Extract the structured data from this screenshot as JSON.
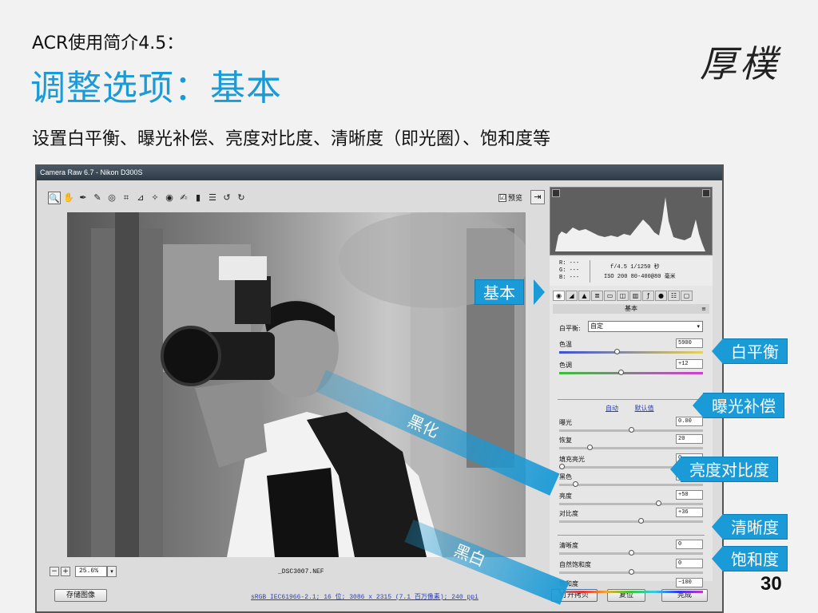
{
  "slide": {
    "subtitle": "ACR使用简介4.5：",
    "title": "调整选项：基本",
    "logo": "厚樸",
    "description": "设置白平衡、曝光补偿、亮度对比度、清晰度（即光圈）、饱和度等",
    "page_number": "30"
  },
  "window": {
    "title": "Camera Raw 6.7 - Nikon D300S",
    "preview_label": "预览",
    "preview_checked": "☑",
    "zoom_minus": "−",
    "zoom_plus": "+",
    "zoom_value": "25.6%",
    "zoom_arrow": "▾",
    "filename": "_DSC3007.NEF",
    "save_button": "存储图像",
    "workflow_link": "sRGB IEC61966-2.1; 16 位; 3086 x 2315 (7.1 百万像素); 240 ppi",
    "open_copy_button": "打开拷贝",
    "reset_button": "复位",
    "done_button": "完成"
  },
  "info": {
    "r": "R:  ---",
    "g": "G:  ---",
    "b": "B:  ---",
    "exif_line1": "f/4.5  1/1250 秒",
    "exif_line2": "ISO 200  80-400@80 毫米"
  },
  "panel": {
    "header": "基本",
    "menu_icon": "≡",
    "wb_label": "白平衡:",
    "wb_value": "自定",
    "wb_arrow": "▾",
    "auto_label": "自动",
    "default_label": "默认值",
    "sliders": [
      {
        "label": "色温",
        "value": "5900",
        "position": 0.4
      },
      {
        "label": "色调",
        "value": "+12",
        "position": 0.43
      },
      {
        "label": "曝光",
        "value": "0.00",
        "position": 0.5
      },
      {
        "label": "恢复",
        "value": "20",
        "position": 0.2
      },
      {
        "label": "填充亮光",
        "value": "0",
        "position": 0.0
      },
      {
        "label": "黑色",
        "value": "9",
        "position": 0.1
      },
      {
        "label": "亮度",
        "value": "+50",
        "position": 0.7
      },
      {
        "label": "对比度",
        "value": "+36",
        "position": 0.57
      },
      {
        "label": "清晰度",
        "value": "0",
        "position": 0.5
      },
      {
        "label": "自然饱和度",
        "value": "0",
        "position": 0.5
      },
      {
        "label": "饱和度",
        "value": "−100",
        "position": 0.0
      }
    ]
  },
  "callouts": {
    "basic": "基本",
    "white_balance": "白平衡",
    "exposure": "曝光补偿",
    "brightness_contrast": "亮度对比度",
    "clarity": "清晰度",
    "saturation": "饱和度",
    "blacks_band": "黑化",
    "bw_band": "黑白"
  },
  "colors": {
    "accent": "#1a9ad6",
    "title": "#1a9ad6"
  }
}
